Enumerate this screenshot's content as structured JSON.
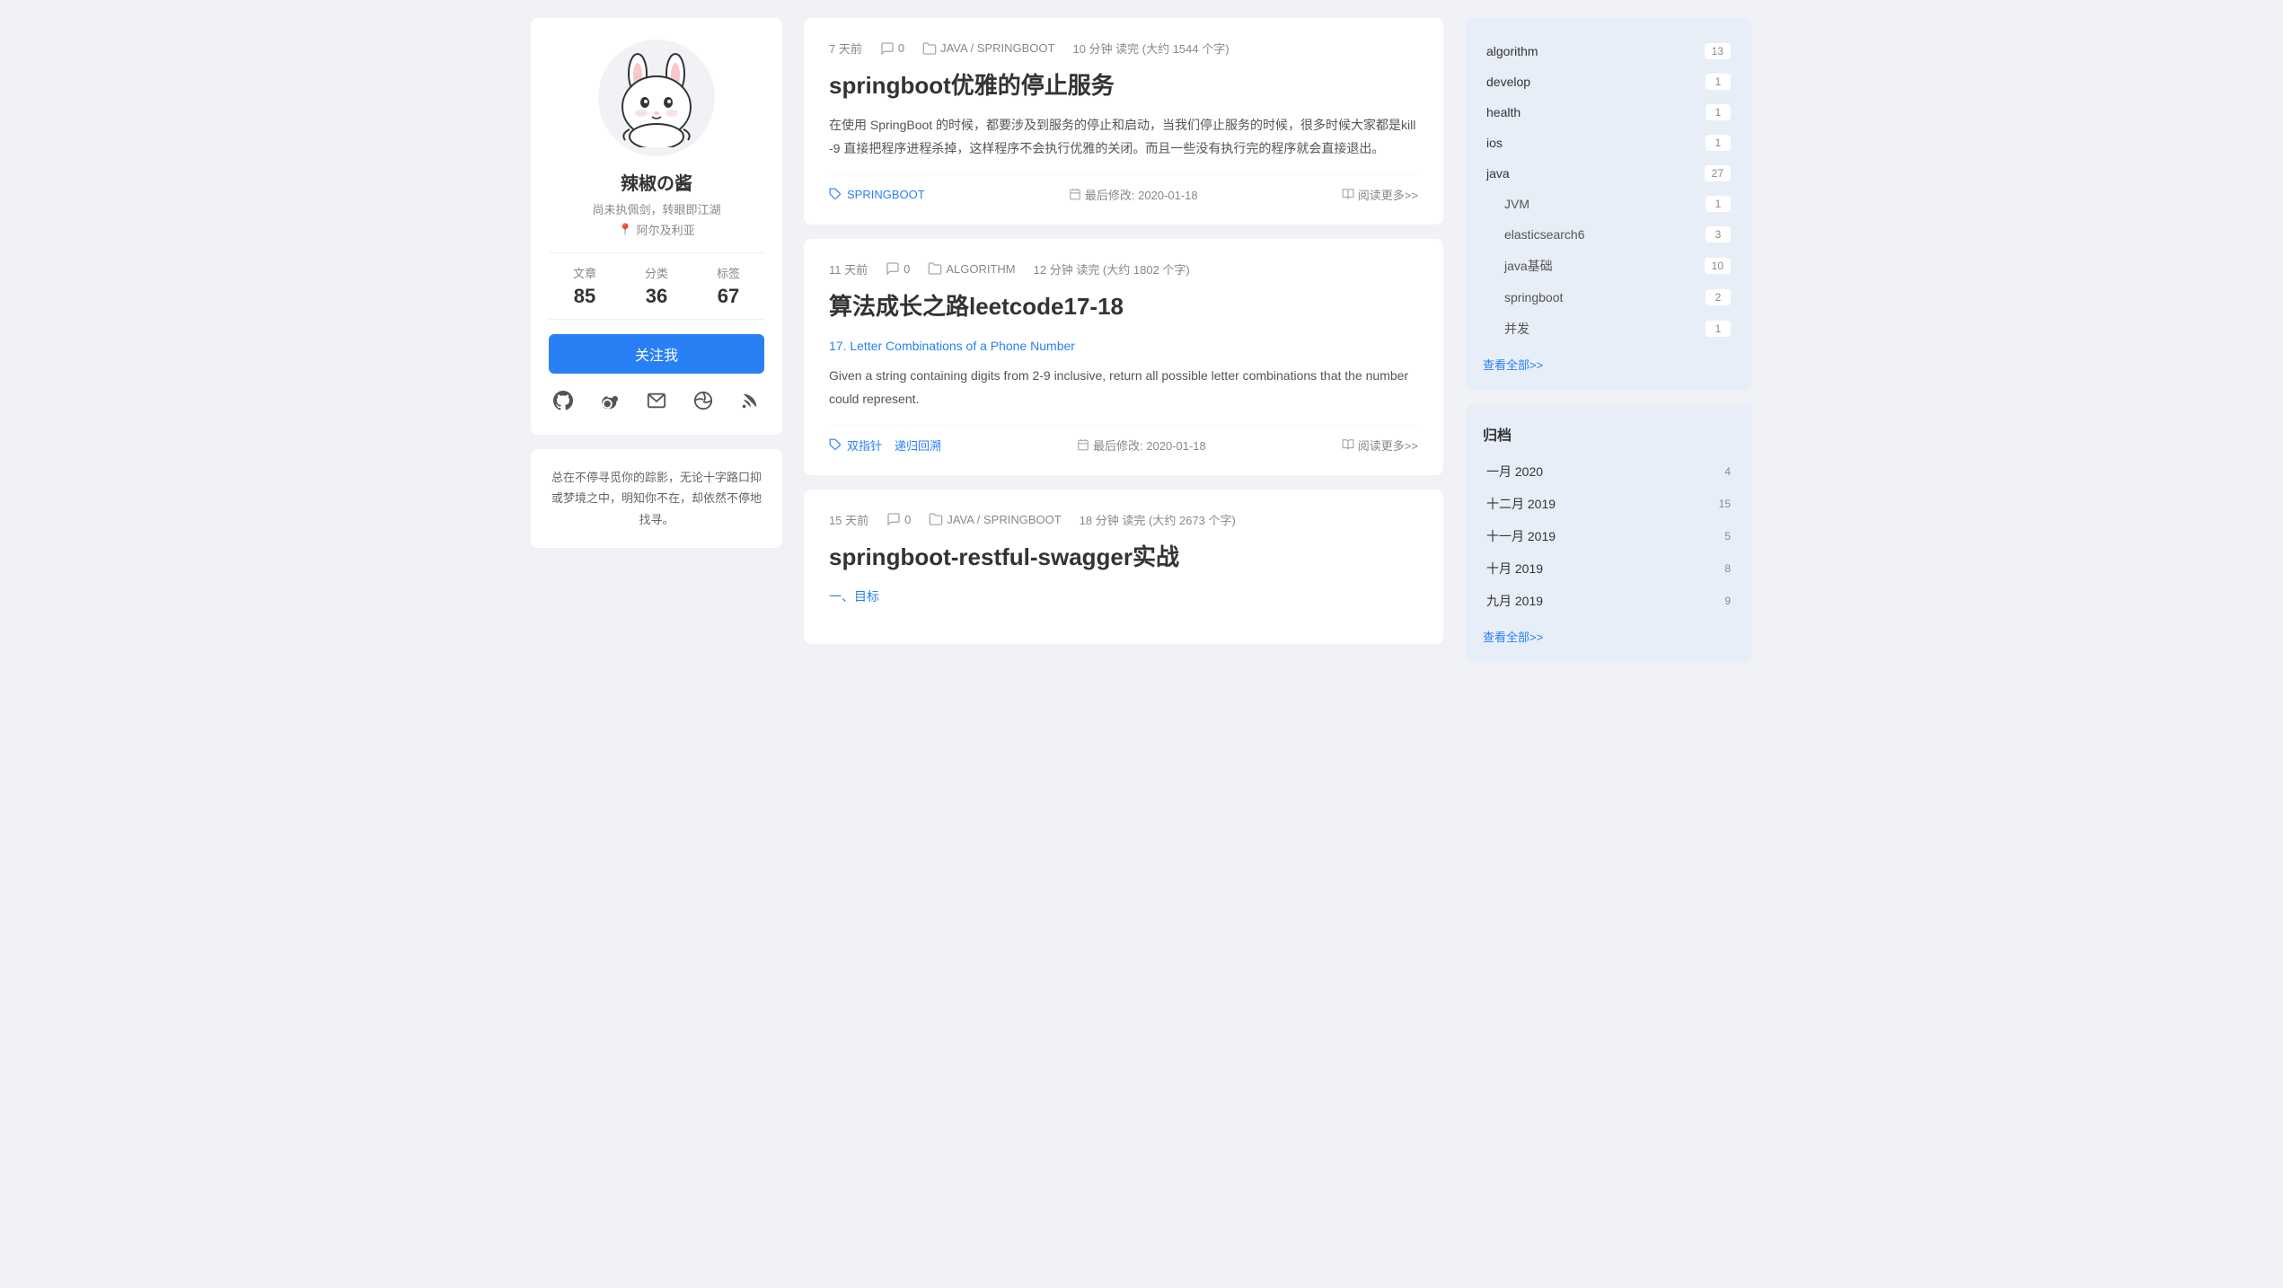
{
  "profile": {
    "username": "辣椒の酱",
    "bio": "尚未执佩剑，转眼即江湖",
    "location": "阿尔及利亚",
    "stats": {
      "articles_label": "文章",
      "articles_value": "85",
      "categories_label": "分类",
      "categories_value": "36",
      "tags_label": "标签",
      "tags_value": "67"
    },
    "follow_button": "关注我",
    "quote": "总在不停寻觅你的踪影，无论十字路口抑或梦境之中，明知你不在，却依然不停地找寻。"
  },
  "articles": [
    {
      "time_ago": "7 天前",
      "comments": "0",
      "category": "JAVA / SPRINGBOOT",
      "read_time": "10 分钟 读完 (大约 1544 个字)",
      "title": "springboot优雅的停止服务",
      "excerpt": "在使用 SpringBoot 的时候，都要涉及到服务的停止和启动，当我们停止服务的时候，很多时候大家都是kill -9 直接把程序进程杀掉，这样程序不会执行优雅的关闭。而且一些没有执行完的程序就会直接退出。",
      "tags": [
        "SPRINGBOOT"
      ],
      "last_modified": "最后修改: 2020-01-18",
      "read_more": "阅读更多>>"
    },
    {
      "time_ago": "11 天前",
      "comments": "0",
      "category": "ALGORITHM",
      "read_time": "12 分钟 读完 (大约 1802 个字)",
      "title": "算法成长之路leetcode17-18",
      "excerpt_link": "17. Letter Combinations of a Phone Number",
      "excerpt": "Given a string containing digits from 2-9 inclusive, return all possible letter combinations that the number could represent.",
      "tags": [
        "双指针",
        "递归回溯"
      ],
      "last_modified": "最后修改: 2020-01-18",
      "read_more": "阅读更多>>"
    },
    {
      "time_ago": "15 天前",
      "comments": "0",
      "category": "JAVA / SPRINGBOOT",
      "read_time": "18 分钟 读完 (大约 2673 个字)",
      "title": "springboot-restful-swagger实战",
      "excerpt_link": "一、目标",
      "excerpt": "",
      "tags": [],
      "last_modified": "",
      "read_more": ""
    }
  ],
  "categories": {
    "title": "",
    "items": [
      {
        "name": "algorithm",
        "count": "13",
        "sub": false
      },
      {
        "name": "develop",
        "count": "1",
        "sub": false
      },
      {
        "name": "health",
        "count": "1",
        "sub": false
      },
      {
        "name": "ios",
        "count": "1",
        "sub": false
      },
      {
        "name": "java",
        "count": "27",
        "sub": false
      },
      {
        "name": "JVM",
        "count": "1",
        "sub": true
      },
      {
        "name": "elasticsearch6",
        "count": "3",
        "sub": true
      },
      {
        "name": "java基础",
        "count": "10",
        "sub": true
      },
      {
        "name": "springboot",
        "count": "2",
        "sub": true
      },
      {
        "name": "并发",
        "count": "1",
        "sub": true
      }
    ],
    "view_all": "查看全部>>"
  },
  "archive": {
    "title": "归档",
    "items": [
      {
        "name": "一月 2020",
        "count": "4"
      },
      {
        "name": "十二月 2019",
        "count": "15"
      },
      {
        "name": "十一月 2019",
        "count": "5"
      },
      {
        "name": "十月 2019",
        "count": "8"
      },
      {
        "name": "九月 2019",
        "count": "9"
      }
    ],
    "view_all": "查看全部>>"
  }
}
